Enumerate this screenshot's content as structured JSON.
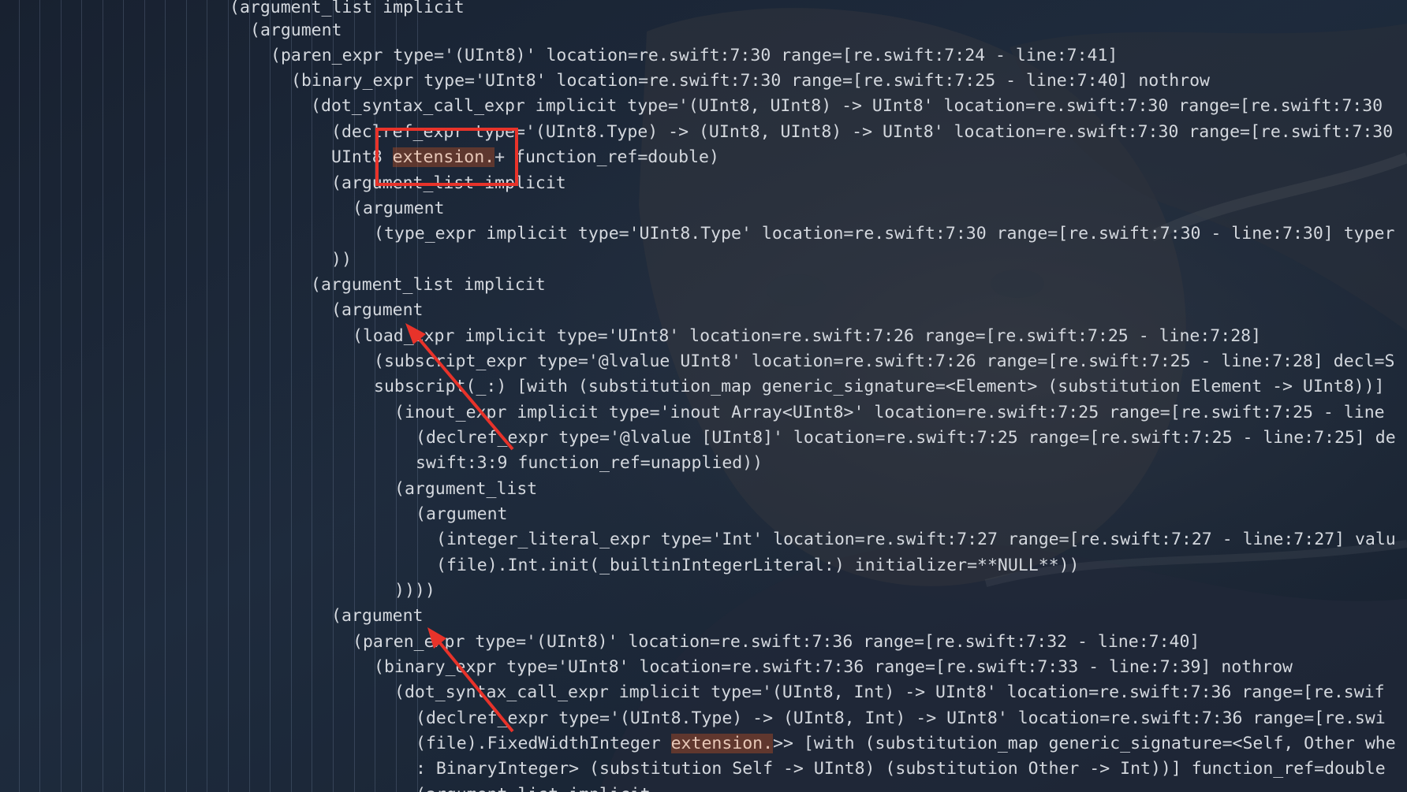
{
  "colors": {
    "background": "#1a2433",
    "text": "#d4d8de",
    "search_highlight": "#8a3f24",
    "annotation": "#e8332a"
  },
  "code": {
    "lines": [
      {
        "text": "(argument_list implicit"
      },
      {
        "text": "(argument"
      },
      {
        "text": "(paren_expr type='(UInt8)' location=re.swift:7:30 range=[re.swift:7:24 - line:7:41]"
      },
      {
        "text": "(binary_expr type='UInt8' location=re.swift:7:30 range=[re.swift:7:25 - line:7:40] nothrow"
      },
      {
        "text": "(dot_syntax_call_expr implicit type='(UInt8, UInt8) -> UInt8' location=re.swift:7:30 range=[re.swift:7:30"
      },
      {
        "text": "(declref_expr type='(UInt8.Type) -> (UInt8, UInt8) -> UInt8' location=re.swift:7:30 range=[re.swift:7:30"
      },
      {
        "before": "UInt8 ",
        "match": "extension.",
        "after": "+ function_ref=double)"
      },
      {
        "text": "(argument_list implicit"
      },
      {
        "text": "(argument"
      },
      {
        "text": "(type_expr implicit type='UInt8.Type' location=re.swift:7:30 range=[re.swift:7:30 - line:7:30] typer"
      },
      {
        "text": "))"
      },
      {
        "text": "(argument_list implicit"
      },
      {
        "text": "(argument"
      },
      {
        "text": "(load_expr implicit type='UInt8' location=re.swift:7:26 range=[re.swift:7:25 - line:7:28]"
      },
      {
        "text": "(subscript_expr type='@lvalue UInt8' location=re.swift:7:26 range=[re.swift:7:25 - line:7:28] decl=S"
      },
      {
        "text": "subscript(_:) [with (substitution_map generic_signature=<Element> (substitution Element -> UInt8))]"
      },
      {
        "text": "(inout_expr implicit type='inout Array<UInt8>' location=re.swift:7:25 range=[re.swift:7:25 - line"
      },
      {
        "text": "(declref_expr type='@lvalue [UInt8]' location=re.swift:7:25 range=[re.swift:7:25 - line:7:25] de"
      },
      {
        "text": "swift:3:9 function_ref=unapplied))"
      },
      {
        "text": "(argument_list"
      },
      {
        "text": "(argument"
      },
      {
        "text": "(integer_literal_expr type='Int' location=re.swift:7:27 range=[re.swift:7:27 - line:7:27] valu"
      },
      {
        "text": "(file).Int.init(_builtinIntegerLiteral:) initializer=**NULL**))"
      },
      {
        "text": "))))"
      },
      {
        "text": "(argument"
      },
      {
        "text": "(paren_expr type='(UInt8)' location=re.swift:7:36 range=[re.swift:7:32 - line:7:40]"
      },
      {
        "text": "(binary_expr type='UInt8' location=re.swift:7:36 range=[re.swift:7:33 - line:7:39] nothrow"
      },
      {
        "text": "(dot_syntax_call_expr implicit type='(UInt8, Int) -> UInt8' location=re.swift:7:36 range=[re.swif"
      },
      {
        "text": "(declref_expr type='(UInt8.Type) -> (UInt8, Int) -> UInt8' location=re.swift:7:36 range=[re.swi"
      },
      {
        "before": "(file).FixedWidthInteger ",
        "match": "extension.",
        "after": ">> [with (substitution_map generic_signature=<Self, Other whe"
      },
      {
        "text": ": BinaryInteger> (substitution Self -> UInt8) (substitution Other -> Int))] function_ref=double"
      },
      {
        "text": "(argument_list implicit"
      }
    ]
  }
}
